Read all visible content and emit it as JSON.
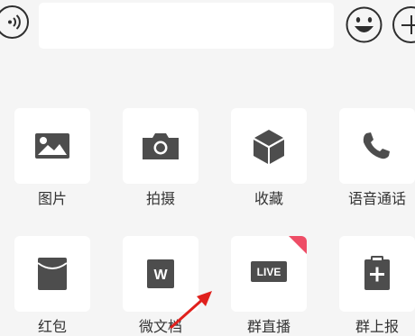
{
  "input": {
    "placeholder": ""
  },
  "panel": {
    "items": [
      {
        "label": "图片",
        "icon": "image-icon"
      },
      {
        "label": "拍摄",
        "icon": "camera-icon"
      },
      {
        "label": "收藏",
        "icon": "favorites-box-icon"
      },
      {
        "label": "语音通话",
        "icon": "phone-icon"
      },
      {
        "label": "红包",
        "icon": "red-envelope-icon"
      },
      {
        "label": "微文档",
        "icon": "doc-w-icon",
        "glyph": "W"
      },
      {
        "label": "群直播",
        "icon": "live-icon",
        "glyph": "LIVE",
        "badge_color": "#ee4d66"
      },
      {
        "label": "群上报",
        "icon": "clipboard-plus-icon"
      }
    ]
  },
  "annotation": {
    "arrow_color": "#e0201c"
  },
  "colors": {
    "background": "#f5f5f5",
    "tile": "#ffffff",
    "icon": "#4d4d4d",
    "text": "#333333"
  }
}
